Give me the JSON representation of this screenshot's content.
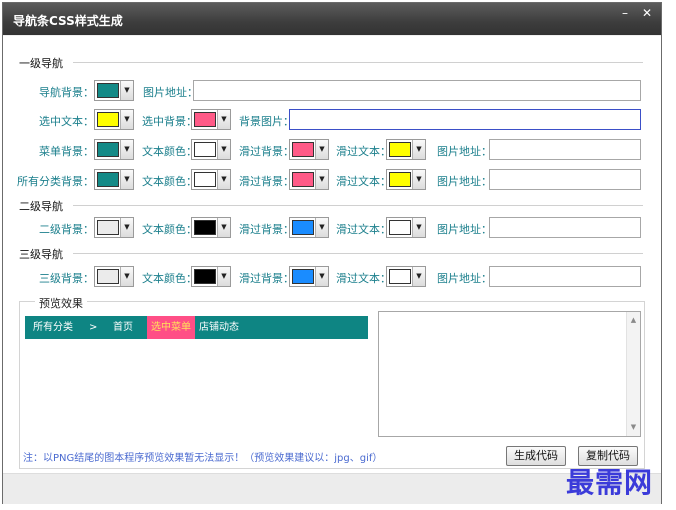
{
  "window": {
    "title": "导航条CSS样式生成",
    "minimize_label": "–",
    "close_label": "✕"
  },
  "sections": {
    "level1": "一级导航",
    "level2": "二级导航",
    "level3": "三级导航"
  },
  "level1": {
    "row1": {
      "nav_bg_label": "导航背景：",
      "nav_bg_color": "#138a87",
      "img_addr_label": "图片地址：",
      "img_addr_value": ""
    },
    "row2": {
      "sel_text_label": "选中文本：",
      "sel_text_color": "#ffff00",
      "sel_bg_label": "选中背景：",
      "sel_bg_color": "#ff5a87",
      "bg_img_label": "背景图片：",
      "bg_img_value": ""
    },
    "row3": {
      "menu_bg_label": "菜单背景：",
      "menu_bg_color": "#138a87",
      "text_color_label": "文本颜色：",
      "text_color": "#ffffff",
      "hover_bg_label": "滑过背景：",
      "hover_bg_color": "#ff5a87",
      "hover_text_label": "滑过文本：",
      "hover_text_color": "#ffff00",
      "img_addr_label": "图片地址：",
      "img_addr_value": ""
    },
    "row4": {
      "all_cat_bg_label": "所有分类背景：",
      "all_cat_bg_color": "#138a87",
      "text_color_label": "文本颜色：",
      "text_color": "#ffffff",
      "hover_bg_label": "滑过背景：",
      "hover_bg_color": "#ff5a87",
      "hover_text_label": "滑过文本：",
      "hover_text_color": "#ffff00",
      "img_addr_label": "图片地址：",
      "img_addr_value": ""
    }
  },
  "level2": {
    "bg_label": "二级背景：",
    "bg_color": "#ebebeb",
    "text_color_label": "文本颜色：",
    "text_color": "#000000",
    "hover_bg_label": "滑过背景：",
    "hover_bg_color": "#1a8cff",
    "hover_text_label": "滑过文本：",
    "hover_text_color": "#ffffff",
    "img_addr_label": "图片地址：",
    "img_addr_value": ""
  },
  "level3": {
    "bg_label": "三级背景：",
    "bg_color": "#ebebeb",
    "text_color_label": "文本颜色：",
    "text_color": "#000000",
    "hover_bg_label": "滑过背景：",
    "hover_bg_color": "#1a8cff",
    "hover_text_label": "滑过文本：",
    "hover_text_color": "#ffffff",
    "img_addr_label": "图片地址：",
    "img_addr_value": ""
  },
  "preview": {
    "group_label": "预览效果",
    "nav_items": [
      {
        "label": "所有分类"
      },
      {
        "label": ">"
      },
      {
        "label": "首页"
      },
      {
        "label": "选中菜单"
      },
      {
        "label": "店铺动态"
      }
    ],
    "nav_bg": "#0e8583",
    "selected_bg": "#ff4f86",
    "selected_text": "#ffe25a",
    "code_output": ""
  },
  "note": "注：以PNG结尾的图本程序预览效果暂无法显示！（预览效果建议以：jpg、gif）",
  "buttons": {
    "generate": "生成代码",
    "copy": "复制代码"
  },
  "watermark": "最需网"
}
